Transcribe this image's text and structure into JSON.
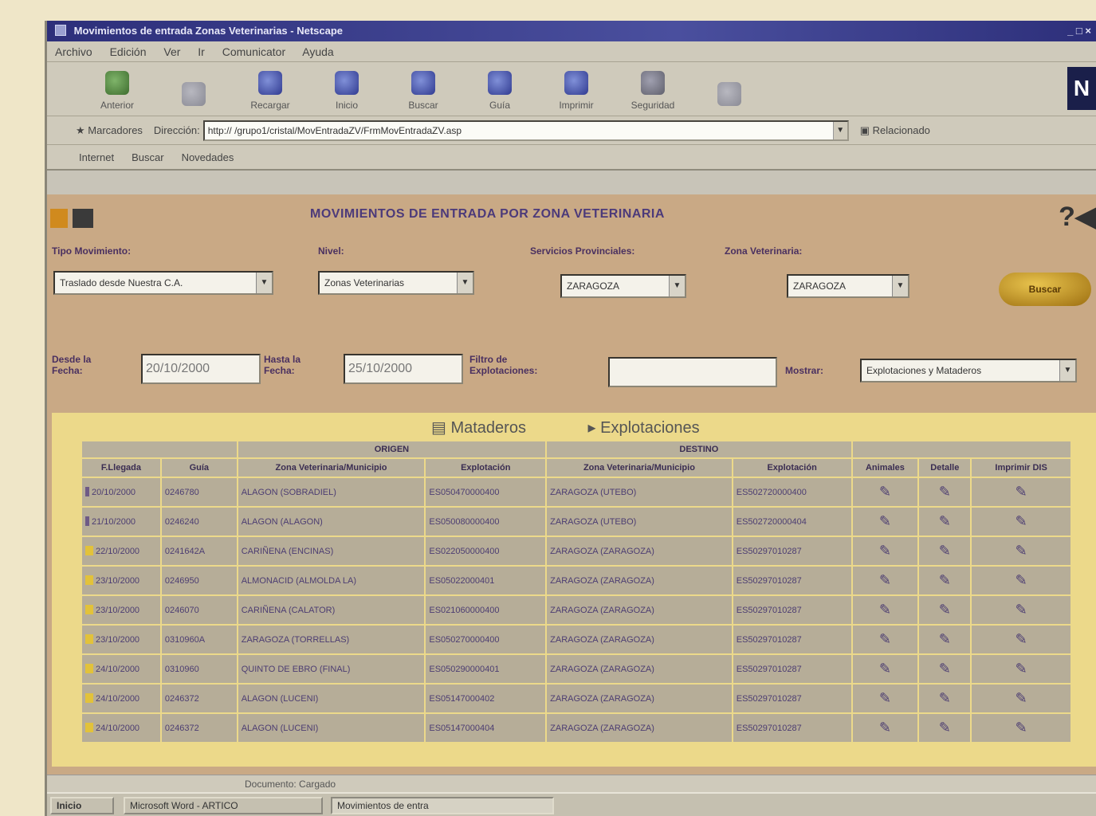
{
  "window": {
    "title": "Movimientos de entrada Zonas Veterinarias - Netscape"
  },
  "menu": [
    "Archivo",
    "Edición",
    "Ver",
    "Ir",
    "Comunicator",
    "Ayuda"
  ],
  "toolbar": [
    {
      "label": "Anterior",
      "icon": "back-arrow-icon"
    },
    {
      "label": "",
      "icon": "forward-arrow-icon"
    },
    {
      "label": "Recargar",
      "icon": "reload-icon"
    },
    {
      "label": "Inicio",
      "icon": "home-icon"
    },
    {
      "label": "Buscar",
      "icon": "search-icon"
    },
    {
      "label": "Guía",
      "icon": "guide-icon"
    },
    {
      "label": "Imprimir",
      "icon": "print-icon"
    },
    {
      "label": "Seguridad",
      "icon": "security-icon"
    },
    {
      "label": "",
      "icon": "stop-icon"
    }
  ],
  "location": {
    "bookmarks_label": "Marcadores",
    "address_label": "Dirección:",
    "url": "http:// /grupo1/cristal/MovEntradaZV/FrmMovEntradaZV.asp",
    "related_label": "Relacionado"
  },
  "personal": [
    "Internet",
    "Buscar",
    "Novedades"
  ],
  "page": {
    "title": "MOVIMIENTOS DE ENTRADA POR ZONA VETERINARIA",
    "tipo_label": "Tipo Movimiento:",
    "tipo_value": "Traslado desde Nuestra C.A.",
    "nivel_label": "Nivel:",
    "nivel_value": "Zonas Veterinarias",
    "serv_label": "Servicios Provinciales:",
    "serv_value": "ZARAGOZA",
    "zona_label": "Zona Veterinaria:",
    "zona_value": "ZARAGOZA",
    "buscar_label": "Buscar",
    "desde_label": "Desde la Fecha:",
    "desde_value": "20/10/2000",
    "hasta_label": "Hasta la Fecha:",
    "hasta_value": "25/10/2000",
    "filtro_label": "Filtro de Explotaciones:",
    "filtro_value": "",
    "mostrar_label": "Mostrar:",
    "mostrar_value": "Explotaciones y Mataderos"
  },
  "tabs": [
    "Mataderos",
    "Explotaciones"
  ],
  "table": {
    "group_origen": "ORIGEN",
    "group_destino": "DESTINO",
    "headers": [
      "F.Llegada",
      "Guía",
      "Zona Veterinaria/Municipio",
      "Explotación",
      "Zona Veterinaria/Municipio",
      "Explotación",
      "Animales",
      "Detalle",
      "Imprimir DIS"
    ],
    "rows": [
      {
        "fecha": "20/10/2000",
        "guia": "0246780",
        "zona_o": "ALAGON (SOBRADIEL)",
        "expl_o": "ES050470000400",
        "zona_d": "ZARAGOZA (UTEBO)",
        "expl_d": "ES502720000400"
      },
      {
        "fecha": "21/10/2000",
        "guia": "0246240",
        "zona_o": "ALAGON (ALAGON)",
        "expl_o": "ES050080000400",
        "zona_d": "ZARAGOZA (UTEBO)",
        "expl_d": "ES502720000404"
      },
      {
        "fecha": "22/10/2000",
        "guia": "0241642A",
        "zona_o": "CARIÑENA (ENCINAS)",
        "expl_o": "ES022050000400",
        "zona_d": "ZARAGOZA (ZARAGOZA)",
        "expl_d": "ES50297010287"
      },
      {
        "fecha": "23/10/2000",
        "guia": "0246950",
        "zona_o": "ALMONACID (ALMOLDA LA)",
        "expl_o": "ES05022000401",
        "zona_d": "ZARAGOZA (ZARAGOZA)",
        "expl_d": "ES50297010287"
      },
      {
        "fecha": "23/10/2000",
        "guia": "0246070",
        "zona_o": "CARIÑENA (CALATOR)",
        "expl_o": "ES021060000400",
        "zona_d": "ZARAGOZA (ZARAGOZA)",
        "expl_d": "ES50297010287"
      },
      {
        "fecha": "23/10/2000",
        "guia": "0310960A",
        "zona_o": "ZARAGOZA (TORRELLAS)",
        "expl_o": "ES050270000400",
        "zona_d": "ZARAGOZA (ZARAGOZA)",
        "expl_d": "ES50297010287"
      },
      {
        "fecha": "24/10/2000",
        "guia": "0310960",
        "zona_o": "QUINTO DE EBRO (FINAL)",
        "expl_o": "ES050290000401",
        "zona_d": "ZARAGOZA (ZARAGOZA)",
        "expl_d": "ES50297010287"
      },
      {
        "fecha": "24/10/2000",
        "guia": "0246372",
        "zona_o": "ALAGON (LUCENI)",
        "expl_o": "ES05147000402",
        "zona_d": "ZARAGOZA (ZARAGOZA)",
        "expl_d": "ES50297010287"
      },
      {
        "fecha": "24/10/2000",
        "guia": "0246372",
        "zona_o": "ALAGON (LUCENI)",
        "expl_o": "ES05147000404",
        "zona_d": "ZARAGOZA (ZARAGOZA)",
        "expl_d": "ES50297010287"
      }
    ]
  },
  "status": {
    "text": "Documento: Cargado"
  },
  "taskbar": {
    "start": "Inicio",
    "tasks": [
      "Microsoft Word - ARTICO",
      "Movimientos de entra"
    ]
  }
}
